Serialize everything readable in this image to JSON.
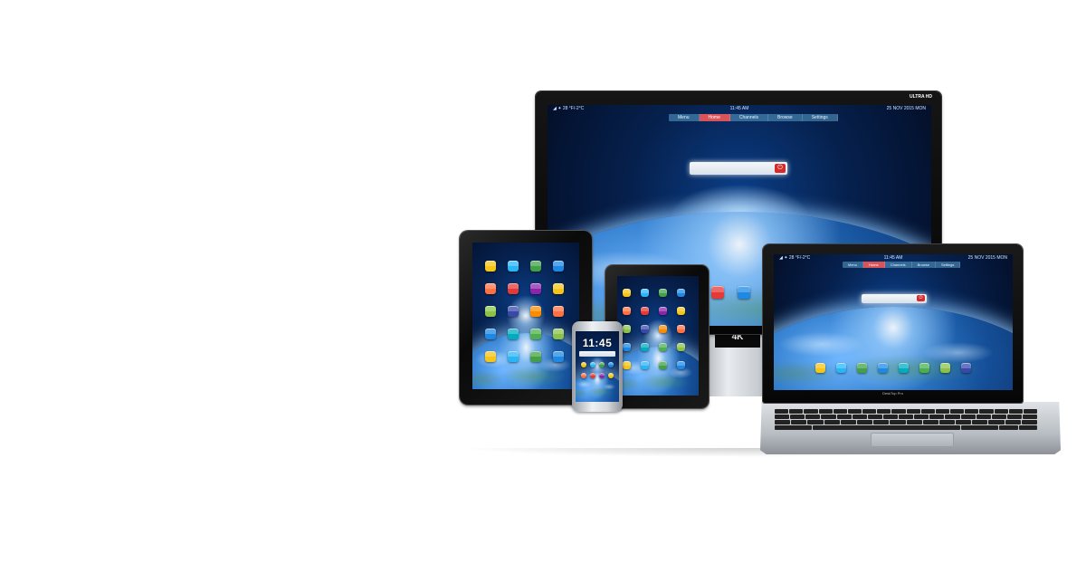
{
  "monitor": {
    "badge": "ULTRA HD",
    "stand_label": "4K",
    "status_left": "◢ ✦ 28 °F/-2°C",
    "status_center": "11:45 AM",
    "status_right": "25 NOV 2015 MON",
    "menu": [
      "Menu",
      "Home",
      "Channels",
      "Browse",
      "Settings"
    ],
    "active_menu": "Home"
  },
  "laptop": {
    "status_left": "◢ ✦ 28 °F/-2°C",
    "status_center": "11:45 AM",
    "status_right": "25 NOV 2015 MON",
    "menu": [
      "Menu",
      "Home",
      "Channels",
      "Browse",
      "Settings"
    ],
    "brand": "DeskTop Pro"
  },
  "phone": {
    "clock": "11:45"
  },
  "icon_colors": [
    "#f5c518",
    "#4caf50",
    "#e53935",
    "#1e88e5",
    "#fb8c00",
    "#29b6f6",
    "#8bc34a",
    "#8e24aa",
    "#00acc1",
    "#ff7043",
    "#43a047",
    "#3949ab"
  ]
}
